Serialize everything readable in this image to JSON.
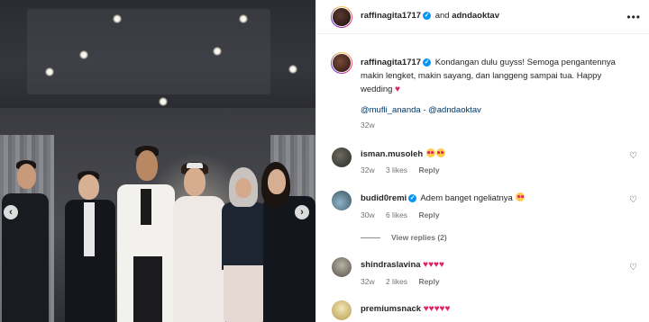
{
  "post": {
    "author": "raffinagita1717",
    "and_text": "and",
    "collaborator": "adndaoktav",
    "more_icon": "more-horizontal-icon"
  },
  "caption": {
    "username": "raffinagita1717",
    "text": "Kondangan dulu guyss! Semoga pengantennya makin lengket, makin sayang, dan langgeng sampai tua. Happy wedding",
    "mentions": "@mufli_ananda - @adndaoktav",
    "time": "32w"
  },
  "comments": [
    {
      "username": "isman.musoleh",
      "text": "",
      "emoji_count": 2,
      "time": "32w",
      "likes": "3 likes",
      "reply": "Reply"
    },
    {
      "username": "budid0remi",
      "text": "Adem banget ngeliatnya",
      "emoji_count": 1,
      "time": "30w",
      "likes": "6 likes",
      "reply": "Reply"
    },
    {
      "username": "shindraslavina",
      "text": "",
      "hearts": "♥♥♥♥",
      "time": "32w",
      "likes": "2 likes",
      "reply": "Reply"
    },
    {
      "username": "premiumsnack",
      "text": "",
      "hearts": "♥♥♥♥♥",
      "time": "",
      "likes": "",
      "reply": ""
    }
  ],
  "view_replies": "View replies (2)",
  "colors": {
    "accent": "#0095f6",
    "link": "#00376b",
    "heart": "#e0245e",
    "muted": "#737373"
  }
}
